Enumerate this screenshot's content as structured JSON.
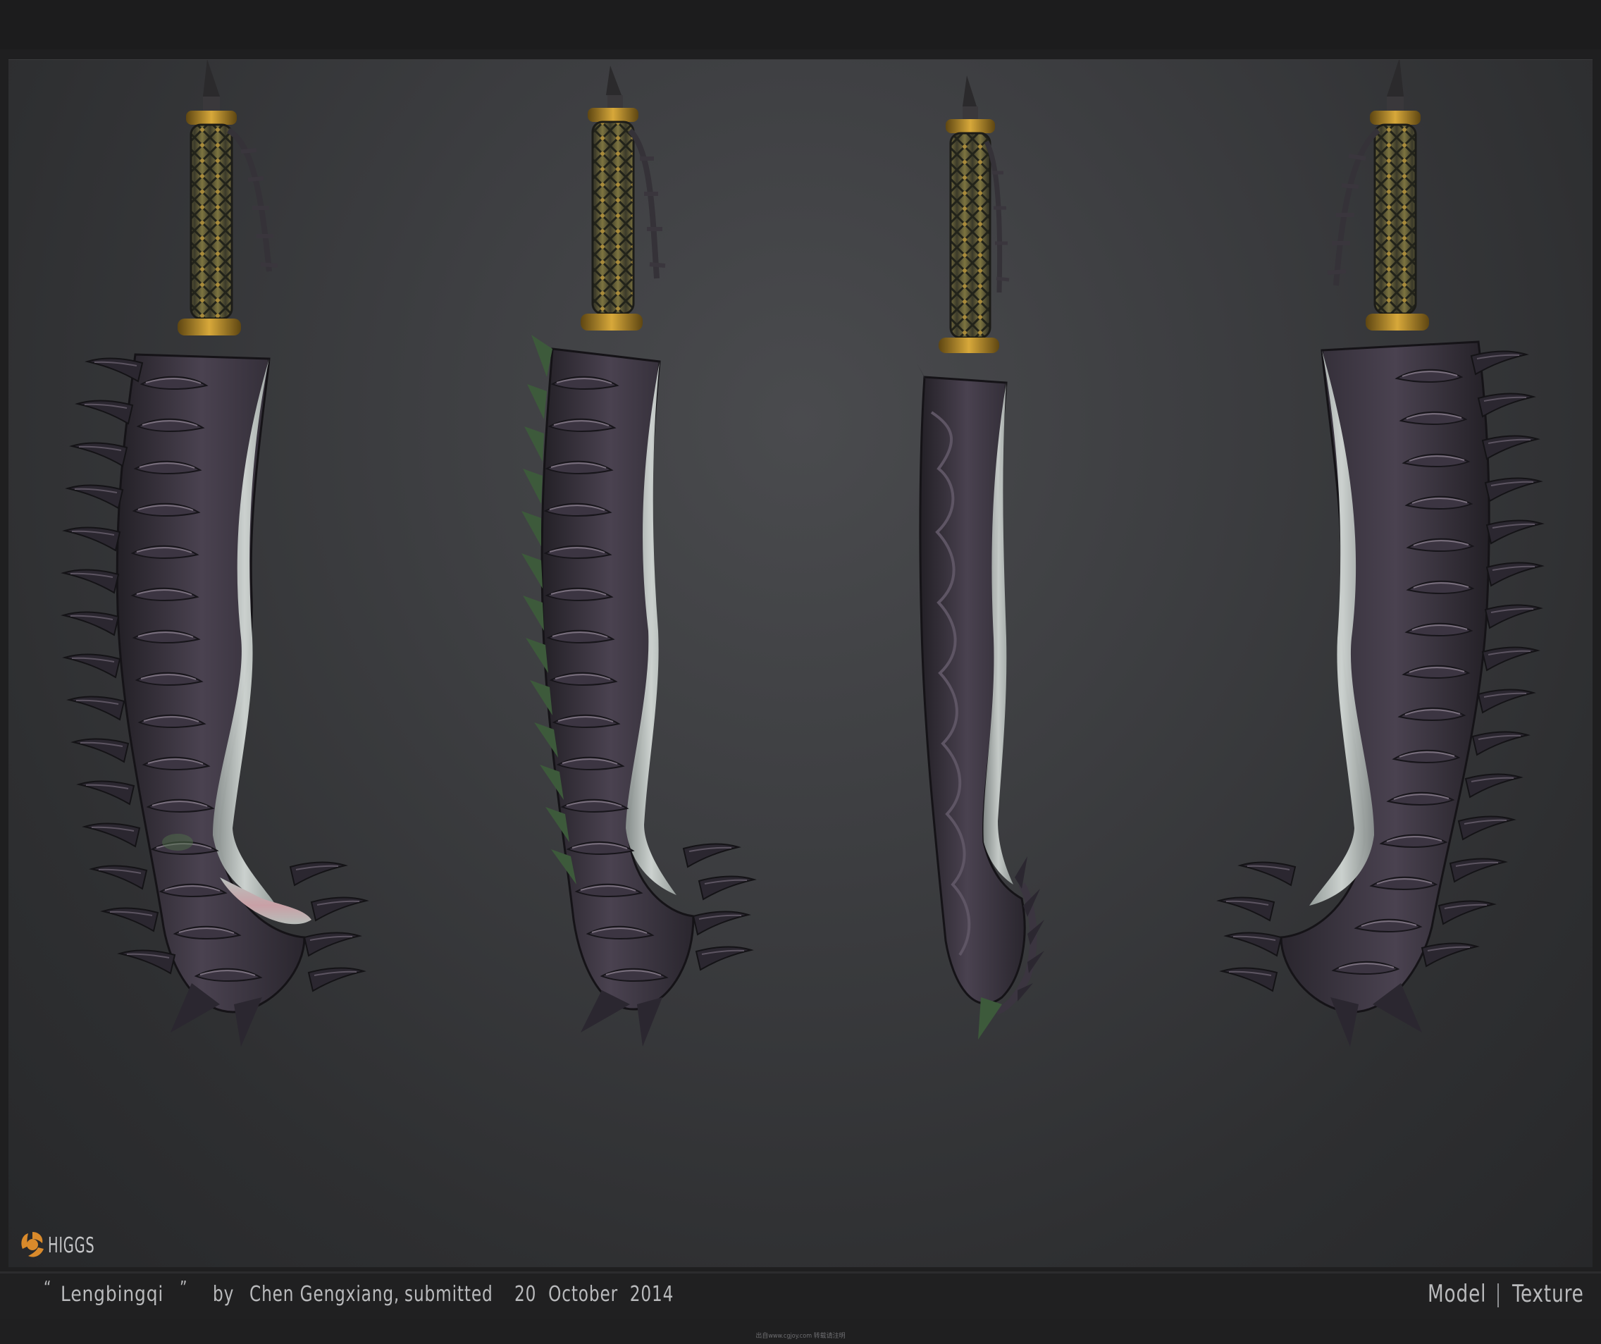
{
  "caption": {
    "open_quote": "“",
    "title": "Lengbingqi",
    "close_quote": "”",
    "by": "by",
    "author": "Chen Gengxiang,",
    "submitted": "submitted",
    "date": "20 October 2014",
    "tab_model": "Model",
    "tab_texture": "Texture"
  },
  "logo": {
    "text": "HIGGS",
    "accent": "#d98a2b"
  },
  "footer_note": "出自www.cgjoy.com 转载请注明",
  "scene": {
    "subject": "four views of a curved serrated blade",
    "colors": {
      "background": "#3d3e41",
      "metal_dark": "#2a2630",
      "metal_mid": "#4d4552",
      "edge_silver": "#b8c0bc",
      "edge_pink": "#c9a3a8",
      "grip": "#6f6a3c",
      "guard_gold": "#b88d2a",
      "moss": "#4f6e4a"
    }
  }
}
